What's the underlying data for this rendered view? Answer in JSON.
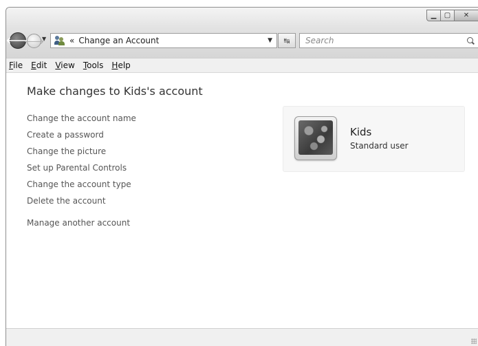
{
  "window": {
    "caption": {
      "minimize_icon": "minimize-icon",
      "maximize_icon": "maximize-icon",
      "close_icon": "close-icon"
    }
  },
  "nav": {
    "back_glyph": "🡐",
    "forward_glyph": "🡒",
    "breadcrumb_chevron": "«",
    "address_text": "Change an Account",
    "search_placeholder": "Search"
  },
  "menu": {
    "items": [
      {
        "key": "F",
        "rest": "ile"
      },
      {
        "key": "E",
        "rest": "dit"
      },
      {
        "key": "V",
        "rest": "iew"
      },
      {
        "key": "T",
        "rest": "ools"
      },
      {
        "key": "H",
        "rest": "elp"
      }
    ]
  },
  "main": {
    "title": "Make changes to Kids's account",
    "tasks": [
      "Change the account name",
      "Create a password",
      "Change the picture",
      "Set up Parental Controls",
      "Change the account type",
      "Delete the account"
    ],
    "other_task": "Manage another account"
  },
  "account": {
    "name": "Kids",
    "type": "Standard user"
  }
}
